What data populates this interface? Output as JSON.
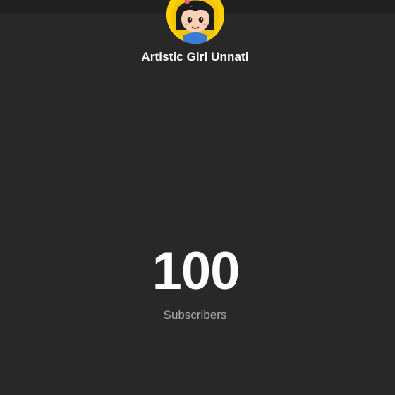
{
  "channel": {
    "name": "Artistic Girl Unnati",
    "avatar_icon": "cartoon-girl-avatar",
    "avatar_ring_color": "#ffd000"
  },
  "stats": {
    "subscriber_count": "100",
    "subscriber_label": "Subscribers"
  },
  "colors": {
    "background": "#282828",
    "top_bar": "#212121",
    "primary_text": "#ffffff",
    "secondary_text": "#aaaaaa"
  }
}
